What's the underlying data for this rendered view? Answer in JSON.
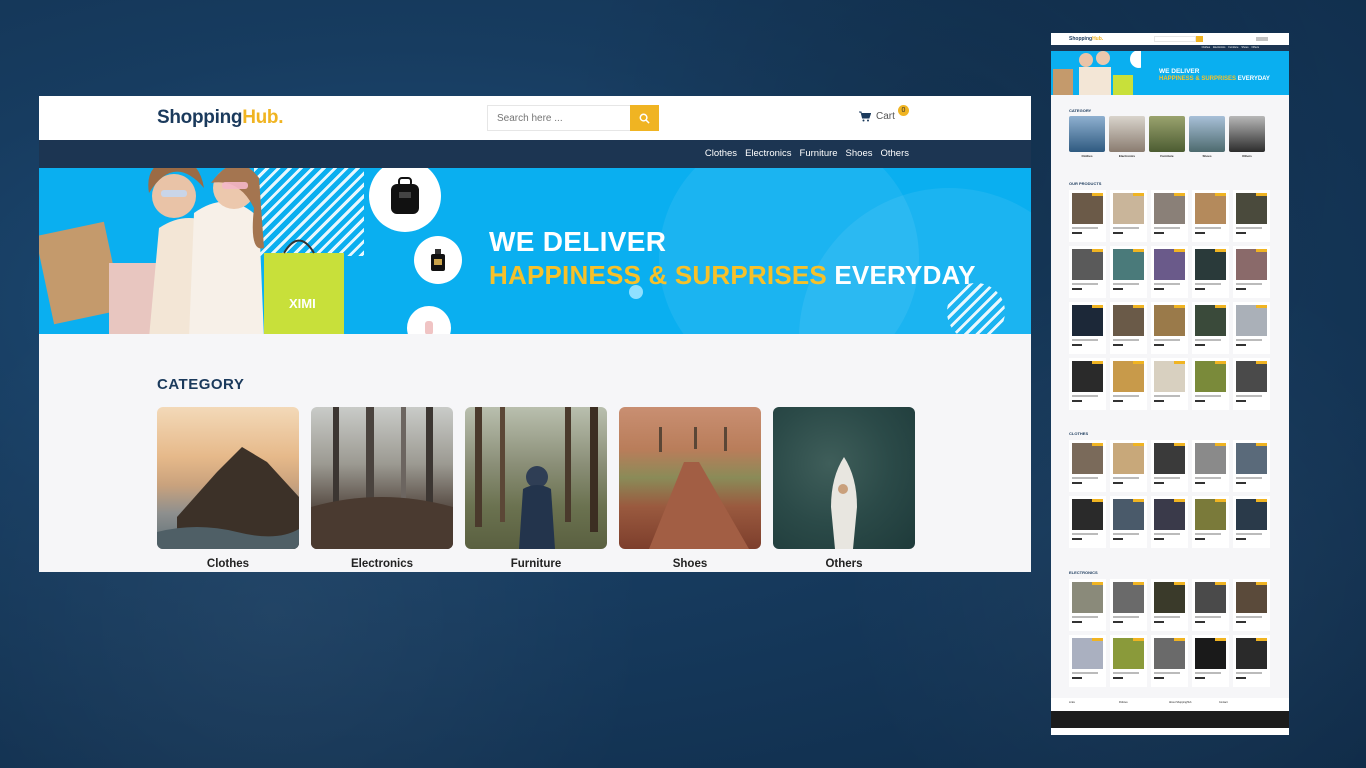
{
  "site": {
    "logo_main": "Shopping",
    "logo_accent": "Hub."
  },
  "search": {
    "placeholder": "Search here ..."
  },
  "cart": {
    "label": "Cart",
    "count": "0"
  },
  "nav": {
    "items": [
      "Clothes",
      "Electronics",
      "Furniture",
      "Shoes",
      "Others"
    ]
  },
  "banner": {
    "line1": "WE DELIVER",
    "line2_highlight": "HAPPINESS & SURPRISES",
    "line2_rest": "EVERYDAY",
    "bag_brand": "XIMI"
  },
  "category": {
    "title": "CATEGORY",
    "items": [
      {
        "label": "Clothes",
        "icon": "coastal-rock-sunset-image"
      },
      {
        "label": "Electronics",
        "icon": "misty-forest-image"
      },
      {
        "label": "Furniture",
        "icon": "person-in-forest-image"
      },
      {
        "label": "Shoes",
        "icon": "autumn-path-image"
      },
      {
        "label": "Others",
        "icon": "boat-aerial-image"
      }
    ]
  },
  "side_preview": {
    "category_title": "CATEGORY",
    "products_title": "OUR PRODUCTS",
    "clothes_title": "CLOTHES",
    "electronics_title": "ELECTRONICS",
    "footer_cols": [
      "Links",
      "Policies",
      "About ShoppingHub",
      "Contact"
    ]
  },
  "colors": {
    "brand_navy": "#1b3a5c",
    "accent_yellow": "#f0b422",
    "banner_blue": "#0aaff0",
    "nav_bg": "#1c3552",
    "page_bg": "#173c60"
  }
}
